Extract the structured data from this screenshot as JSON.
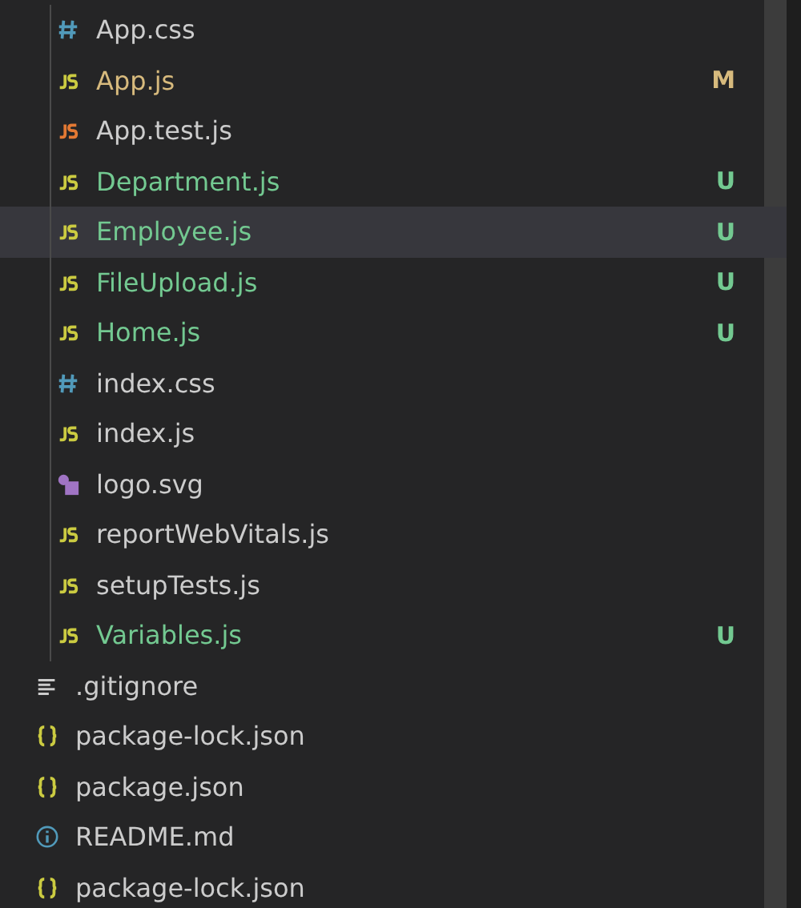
{
  "tree": [
    {
      "children": [
        {
          "children": [
            {
              "name": "App.css",
              "kind": "css",
              "modified": false,
              "untracked": false,
              "selected": false
            },
            {
              "name": "App.js",
              "kind": "js",
              "modified": true,
              "untracked": false,
              "badge": "M",
              "selected": false
            },
            {
              "name": "App.test.js",
              "kind": "test",
              "modified": false,
              "untracked": false,
              "selected": false
            },
            {
              "name": "Department.js",
              "kind": "js",
              "modified": false,
              "untracked": true,
              "badge": "U",
              "selected": false
            },
            {
              "name": "Employee.js",
              "kind": "js",
              "modified": false,
              "untracked": true,
              "badge": "U",
              "selected": true
            },
            {
              "name": "FileUpload.js",
              "kind": "js",
              "modified": false,
              "untracked": true,
              "badge": "U",
              "selected": false
            },
            {
              "name": "Home.js",
              "kind": "js",
              "modified": false,
              "untracked": true,
              "badge": "U",
              "selected": false
            },
            {
              "name": "index.css",
              "kind": "css",
              "modified": false,
              "untracked": false,
              "selected": false
            },
            {
              "name": "index.js",
              "kind": "js",
              "modified": false,
              "untracked": false,
              "selected": false
            },
            {
              "name": "logo.svg",
              "kind": "svg",
              "modified": false,
              "untracked": false,
              "selected": false
            },
            {
              "name": "reportWebVitals.js",
              "kind": "js",
              "modified": false,
              "untracked": false,
              "selected": false
            },
            {
              "name": "setupTests.js",
              "kind": "js",
              "modified": false,
              "untracked": false,
              "selected": false
            },
            {
              "name": "Variables.js",
              "kind": "js",
              "modified": false,
              "untracked": true,
              "badge": "U",
              "selected": false
            }
          ]
        },
        {
          "name": ".gitignore",
          "kind": "text",
          "modified": false,
          "untracked": false,
          "selected": false
        },
        {
          "name": "package-lock.json",
          "kind": "json",
          "modified": false,
          "untracked": false,
          "selected": false
        },
        {
          "name": "package.json",
          "kind": "json",
          "modified": false,
          "untracked": false,
          "selected": false
        },
        {
          "name": "README.md",
          "kind": "info",
          "modified": false,
          "untracked": false,
          "selected": false
        }
      ]
    },
    {
      "name": "package-lock.json",
      "kind": "json",
      "modified": false,
      "untracked": false,
      "selected": false
    }
  ]
}
